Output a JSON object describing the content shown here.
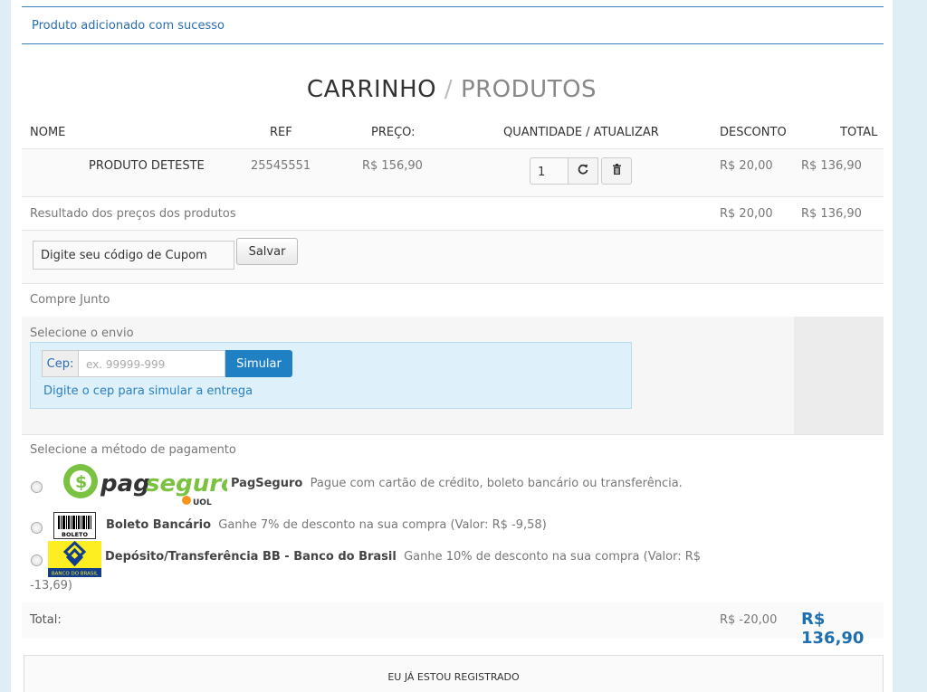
{
  "alert": {
    "message": "Produto adicionado com sucesso"
  },
  "title": {
    "main": "CARRINHO",
    "separator": "/",
    "sub": "PRODUTOS"
  },
  "table": {
    "headers": {
      "name": "NOME",
      "ref": "REF",
      "price": "PREÇO:",
      "qty": "QUANTIDADE / ATUALIZAR",
      "discount": "DESCONTO",
      "total": "TOTAL"
    },
    "rows": [
      {
        "name": "PRODUTO DETESTE",
        "ref": "25545551",
        "price": "R$ 156,90",
        "qty": "1",
        "discount": "R$ 20,00",
        "total": "R$ 136,90"
      }
    ]
  },
  "summary": {
    "label": "Resultado dos preços dos produtos",
    "discount": "R$ 20,00",
    "total": "R$ 136,90"
  },
  "coupon": {
    "placeholder": "Digite seu código de Cupom",
    "button": "Salvar"
  },
  "compre_junto": "Compre Junto",
  "shipping": {
    "label": "Selecione o envio",
    "cep_label": "Cep:",
    "cep_placeholder": "ex. 99999-999",
    "simulate_button": "Simular",
    "help": "Digite o cep para simular a entrega"
  },
  "payment": {
    "label": "Selecione a método de pagamento",
    "methods": [
      {
        "name": "PagSeguro",
        "desc": "Pague com cartão de crédito, boleto bancário ou transferência.",
        "logo_text": "pagseguro",
        "logo_sub": "UOL"
      },
      {
        "name": "Boleto Bancário",
        "desc": "Ganhe 7% de desconto na sua compra (Valor: R$ -9,58)",
        "logo_text": "BOLETO"
      },
      {
        "name": "Depósito/Transferência BB - Banco do Brasil",
        "desc": "Ganhe 10% de desconto na sua compra (Valor: R$",
        "desc2": "-13,69)",
        "logo_text": "BANCO DO BRASIL"
      }
    ]
  },
  "totals": {
    "label": "Total:",
    "discount": "R$ -20,00",
    "total": "R$ 136,90"
  },
  "login": {
    "label": "EU JÁ ESTOU REGISTRADO"
  },
  "colors": {
    "accent": "#1f80c4",
    "total_value": "#1f6fae",
    "link": "#2a6db3"
  }
}
